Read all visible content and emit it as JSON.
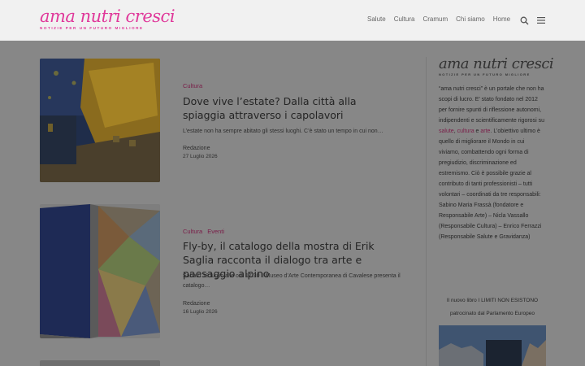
{
  "brand": {
    "name": "ama nutri cresci",
    "tagline": "NOTIZIE PER UN FUTURO MIGLIORE",
    "accent_color": "#e0389a"
  },
  "nav": {
    "items": [
      "Salute",
      "Cultura",
      "Cramum",
      "Chi siamo",
      "Home"
    ],
    "search_icon": "search-icon",
    "menu_icon": "hamburger-menu-icon"
  },
  "posts": [
    {
      "categories": [
        "Cultura"
      ],
      "title": "Dove vive l’estate? Dalla città alla spiaggia attraverso i capolavori",
      "excerpt": "L’estate non ha sempre abitato gli stessi luoghi. C’è stato un tempo in cui non…",
      "author": "Redazione",
      "date": "27 Luglio 2026"
    },
    {
      "categories": [
        "Cultura",
        "Eventi"
      ],
      "title": "Fly-by, il catalogo della mostra di Erik Saglia racconta il dialogo tra arte e paesaggio alpino",
      "excerpt": "Sabato 18 luglio alle ore 17.30 il Museo d’Arte Contemporanea di Cavalese presenta il catalogo…",
      "author": "Redazione",
      "date": "16 Luglio 2026"
    }
  ],
  "sidebar": {
    "logo_name": "ama nutri cresci",
    "logo_tagline": "NOTIZIE PER UN FUTURO MIGLIORE",
    "about_part1": "“ama nutri cresci” è un portale che non ha scopi di lucro. E’ stato fondato nel 2012 per fornire spunti di riflessione autonomi, indipendenti e scientificamente rigorosi su ",
    "link_salute": "salute",
    "comma": ", ",
    "link_cultura": "cultura",
    "and": " e ",
    "link_arte": "arte",
    "about_part2": ". L’obiettivo ultimo è quello di migliorare il Mondo in cui viviamo, combattendo ogni forma di pregiudizio, discriminazione ed estremismo. Ciò è possibile grazie al contributo di tanti professionisti – tutti volontari – coordinati da tre responsabili: Sabino Maria Frassà (fondatore e Responsabile Arte) – Nicla Vassallo (Responsabile Cultura) – Enrico Ferrazzi (Responsabile Salute e Gravidanza)",
    "book_line1": "Il nuovo libro I LIMITI NON ESISTONO",
    "book_line2": "patrocinato dal Parlamento Europeo"
  }
}
